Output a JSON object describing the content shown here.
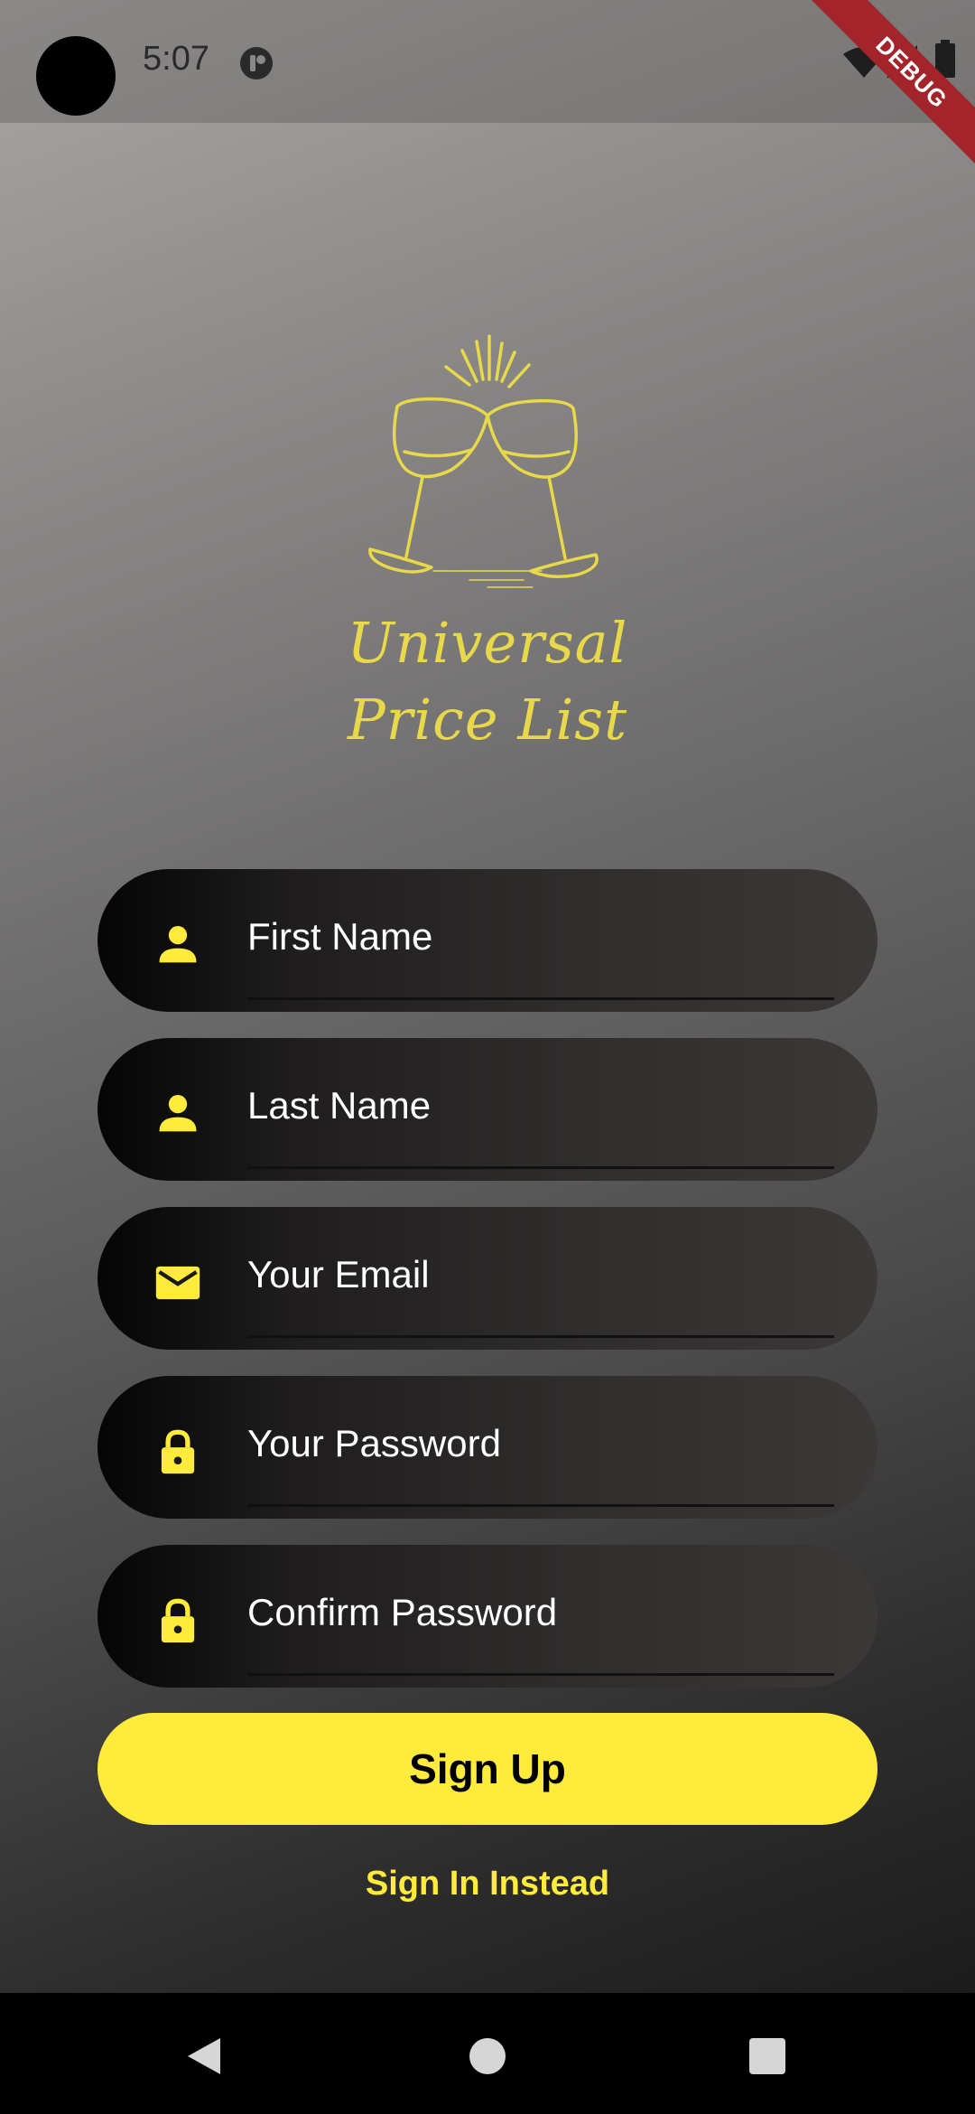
{
  "status_bar": {
    "time": "5:07",
    "debug_label": "DEBUG",
    "icons": [
      "notification-icon",
      "wifi-icon",
      "signal-icon",
      "battery-icon"
    ]
  },
  "brand": {
    "line1": "Universal",
    "line2": "Price List",
    "logo_icon": "clinking-wine-glasses-icon",
    "color": "#e8d94a"
  },
  "form": {
    "fields": [
      {
        "placeholder": "First Name",
        "icon": "person-icon"
      },
      {
        "placeholder": "Last Name",
        "icon": "person-icon"
      },
      {
        "placeholder": "Your Email",
        "icon": "mail-icon"
      },
      {
        "placeholder": "Your Password",
        "icon": "lock-icon"
      },
      {
        "placeholder": "Confirm Password",
        "icon": "lock-icon"
      }
    ],
    "signup_label": "Sign Up",
    "signin_label": "Sign In Instead"
  },
  "colors": {
    "accent": "#ffeb3b",
    "debug_banner": "#a3252b"
  },
  "nav_bar": {
    "icons": [
      "back-icon",
      "home-icon",
      "recents-icon"
    ]
  }
}
